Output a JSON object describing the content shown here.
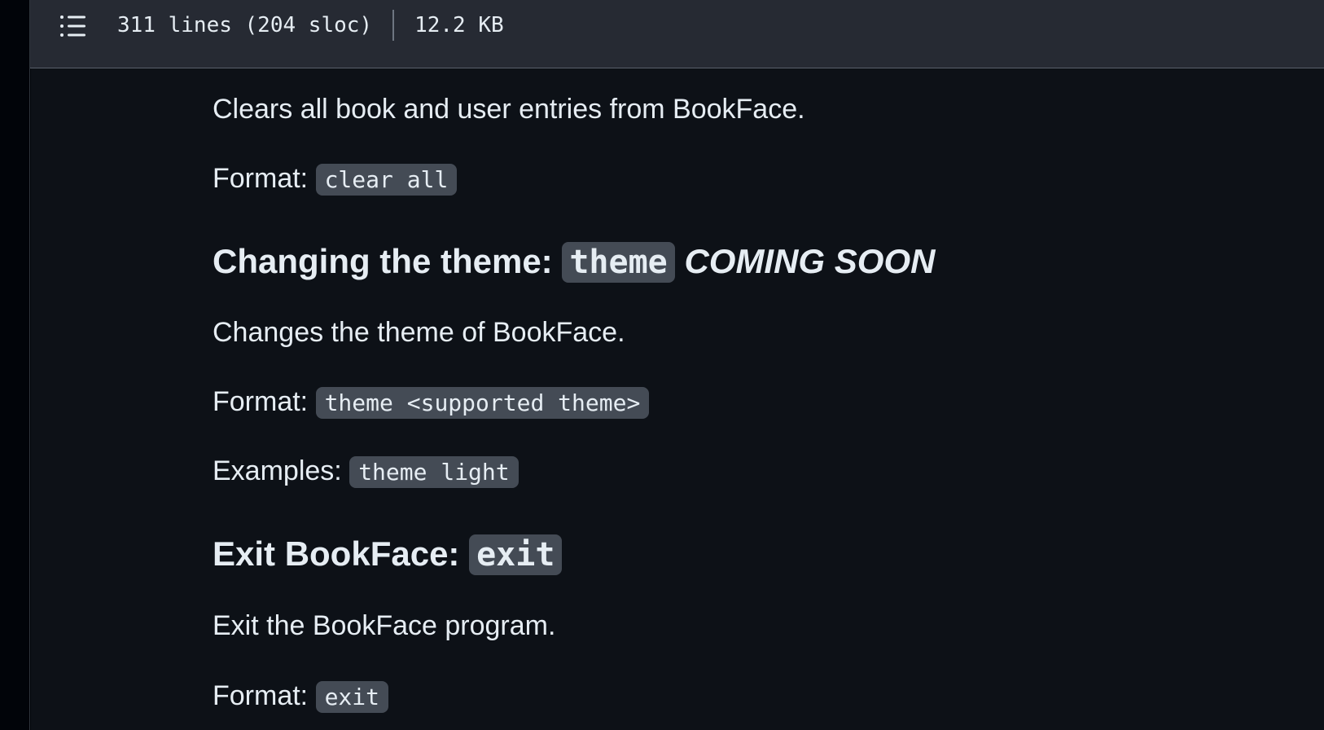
{
  "file_header": {
    "lines": "311 lines (204 sloc)",
    "size": "12.2 KB",
    "toc_icon": "list-icon"
  },
  "doc": {
    "clear_desc": "Clears all book and user entries from BookFace.",
    "format_label": "Format:",
    "clear_format": "clear all",
    "theme_heading": "Changing the theme:",
    "theme_cmd": "theme",
    "theme_soon": "COMING SOON",
    "theme_desc": "Changes the theme of BookFace.",
    "theme_format": "theme <supported theme>",
    "examples_label": "Examples:",
    "theme_example": "theme light",
    "exit_heading": "Exit BookFace:",
    "exit_cmd": "exit",
    "exit_desc": "Exit the BookFace program.",
    "exit_format": "exit"
  },
  "colors": {
    "header_bg": "#262a33",
    "content_bg": "#0d1117",
    "code_bg": "#444b55",
    "text": "#e6edf3"
  }
}
